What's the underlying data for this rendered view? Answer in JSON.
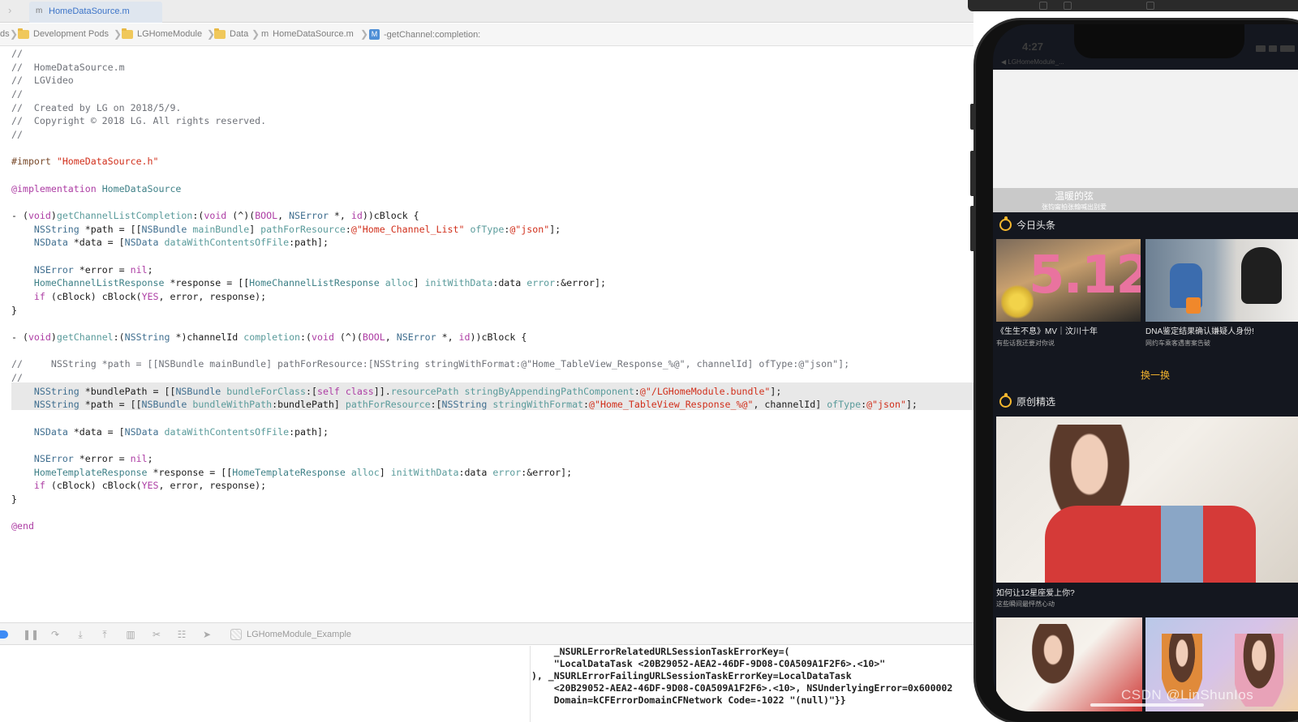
{
  "tabbar": {
    "active_tab": "HomeDataSource.m",
    "file_type_glyph": "m"
  },
  "jumpbar": {
    "items": [
      "ds",
      "Development Pods",
      "LGHomeModule",
      "Data",
      "HomeDataSource.m",
      "-getChannel:completion:"
    ],
    "file_glyph": "m",
    "method_glyph": "M"
  },
  "code": {
    "lines": [
      [
        [
          "c-comment",
          "//"
        ]
      ],
      [
        [
          "c-comment",
          "//  HomeDataSource.m"
        ]
      ],
      [
        [
          "c-comment",
          "//  LGVideo"
        ]
      ],
      [
        [
          "c-comment",
          "//"
        ]
      ],
      [
        [
          "c-comment",
          "//  Created by LG on 2018/5/9."
        ]
      ],
      [
        [
          "c-comment",
          "//  Copyright © 2018 LG. All rights reserved."
        ]
      ],
      [
        [
          "c-comment",
          "//"
        ]
      ],
      [],
      [
        [
          "c-pre",
          "#import "
        ],
        [
          "c-str",
          "\"HomeDataSource.h\""
        ]
      ],
      [],
      [
        [
          "c-kw",
          "@implementation"
        ],
        [
          "",
          " "
        ],
        [
          "c-proj",
          "HomeDataSource"
        ]
      ],
      [],
      [
        [
          "",
          "- ("
        ],
        [
          "c-kw",
          "void"
        ],
        [
          "",
          ")"
        ],
        [
          "c-method",
          "getChannelListCompletion"
        ],
        [
          "",
          ":("
        ],
        [
          "c-kw",
          "void"
        ],
        [
          "",
          " (^)("
        ],
        [
          "c-kw",
          "BOOL"
        ],
        [
          "",
          ", "
        ],
        [
          "c-type",
          "NSError"
        ],
        [
          "",
          " *, "
        ],
        [
          "c-kw",
          "id"
        ],
        [
          "",
          "))cBlock {"
        ]
      ],
      [
        [
          "",
          "    "
        ],
        [
          "c-type",
          "NSString"
        ],
        [
          "",
          " *path = [["
        ],
        [
          "c-type",
          "NSBundle"
        ],
        [
          "",
          "",
          " "
        ],
        [
          "c-method",
          "mainBundle"
        ],
        [
          "",
          "] "
        ],
        [
          "c-method",
          "pathForResource"
        ],
        [
          "",
          ":"
        ],
        [
          "c-str",
          "@\"Home_Channel_List\""
        ],
        [
          "",
          " "
        ],
        [
          "c-method",
          "ofType"
        ],
        [
          "",
          ":"
        ],
        [
          "c-str",
          "@\"json\""
        ],
        [
          "",
          "];"
        ]
      ],
      [
        [
          "",
          "    "
        ],
        [
          "c-type",
          "NSData"
        ],
        [
          "",
          "",
          " *data = ["
        ],
        [
          "c-type",
          "NSData"
        ],
        [
          "",
          " "
        ],
        [
          "c-method",
          "dataWithContentsOfFile"
        ],
        [
          "",
          ":path];"
        ]
      ],
      [],
      [
        [
          "",
          "    "
        ],
        [
          "c-type",
          "NSError"
        ],
        [
          "",
          "",
          " *error = "
        ],
        [
          "c-kw",
          "nil"
        ],
        [
          "",
          ";"
        ]
      ],
      [
        [
          "",
          "    "
        ],
        [
          "c-proj",
          "HomeChannelListResponse"
        ],
        [
          "",
          " *response = [["
        ],
        [
          "c-proj",
          "HomeChannelListResponse"
        ],
        [
          "",
          " "
        ],
        [
          "c-method",
          "alloc"
        ],
        [
          "",
          "] "
        ],
        [
          "c-method",
          "initWithData"
        ],
        [
          "",
          ":data "
        ],
        [
          "c-method",
          "error"
        ],
        [
          "",
          ":&error];"
        ]
      ],
      [
        [
          "",
          "    "
        ],
        [
          "c-kw",
          "if"
        ],
        [
          "",
          " (cBlock) cBlock("
        ],
        [
          "c-kw",
          "YES"
        ],
        [
          "",
          ", error, response);"
        ]
      ],
      [
        [
          "",
          "}"
        ]
      ],
      [],
      [
        [
          "",
          "- ("
        ],
        [
          "c-kw",
          "void"
        ],
        [
          "",
          ")"
        ],
        [
          "c-method",
          "getChannel"
        ],
        [
          "",
          ":("
        ],
        [
          "c-type",
          "NSString"
        ],
        [
          "",
          " *)channelId "
        ],
        [
          "c-method",
          "completion"
        ],
        [
          "",
          ":("
        ],
        [
          "c-kw",
          "void"
        ],
        [
          "",
          "",
          " (^)("
        ],
        [
          "c-kw",
          "BOOL"
        ],
        [
          "",
          ", "
        ],
        [
          "c-type",
          "NSError"
        ],
        [
          "",
          " *, "
        ],
        [
          "c-kw",
          "id"
        ],
        [
          "",
          "))cBlock {"
        ]
      ],
      [],
      [
        [
          "c-comment",
          "//     NSString *path = [[NSBundle mainBundle] pathForResource:[NSString stringWithFormat:@\"Home_TableView_Response_%@\", channelId] ofType:@\"json\"];"
        ]
      ],
      [
        [
          "c-comment",
          "//"
        ]
      ],
      [
        [
          "",
          "    "
        ],
        [
          "c-type",
          "NSString"
        ],
        [
          "",
          " *bundlePath = [["
        ],
        [
          "c-type",
          "NSBundle"
        ],
        [
          "",
          " "
        ],
        [
          "c-method",
          "bundleForClass"
        ],
        [
          "",
          ":["
        ],
        [
          "c-kw",
          "self"
        ],
        [
          "",
          " "
        ],
        [
          "c-kw",
          "class"
        ],
        [
          "",
          "]]."
        ],
        [
          "c-method",
          "resourcePath"
        ],
        [
          "",
          " "
        ],
        [
          "c-method",
          "stringByAppendingPathComponent"
        ],
        [
          "",
          ":"
        ],
        [
          "c-str",
          "@\"/LGHomeModule.bundle\""
        ],
        [
          "",
          "];"
        ]
      ],
      [
        [
          "",
          "    "
        ],
        [
          "c-type",
          "NSString"
        ],
        [
          "",
          " *path = [["
        ],
        [
          "c-type",
          "NSBundle"
        ],
        [
          "",
          " "
        ],
        [
          "c-method",
          "bundleWithPath"
        ],
        [
          "",
          ":bundlePath] "
        ],
        [
          "c-method",
          "pathForResource"
        ],
        [
          "",
          ":["
        ],
        [
          "c-type",
          "NSString"
        ],
        [
          "",
          " "
        ],
        [
          "c-method",
          "stringWithFormat"
        ],
        [
          "",
          ":"
        ],
        [
          "c-str",
          "@\"Home_TableView_Response_%@\""
        ],
        [
          "",
          ", channelId] "
        ],
        [
          "c-method",
          "ofType"
        ],
        [
          "",
          ":"
        ],
        [
          "c-str",
          "@\"json\""
        ],
        [
          "",
          "];"
        ]
      ],
      [],
      [
        [
          "",
          "    "
        ],
        [
          "c-type",
          "NSData"
        ],
        [
          "",
          " *data = ["
        ],
        [
          "c-type",
          "NSData"
        ],
        [
          "",
          " "
        ],
        [
          "c-method",
          "dataWithContentsOfFile"
        ],
        [
          "",
          ":path];"
        ]
      ],
      [],
      [
        [
          "",
          "    "
        ],
        [
          "c-type",
          "NSError"
        ],
        [
          "",
          " *error = "
        ],
        [
          "c-kw",
          "nil"
        ],
        [
          "",
          ";"
        ]
      ],
      [
        [
          "",
          "    "
        ],
        [
          "c-proj",
          "HomeTemplateResponse"
        ],
        [
          "",
          " *response = [["
        ],
        [
          "c-proj",
          "HomeTemplateResponse"
        ],
        [
          "",
          " "
        ],
        [
          "c-method",
          "alloc"
        ],
        [
          "",
          "] "
        ],
        [
          "c-method",
          "initWithData"
        ],
        [
          "",
          ":data "
        ],
        [
          "c-method",
          "error"
        ],
        [
          "",
          ":&error];"
        ]
      ],
      [
        [
          "",
          "    "
        ],
        [
          "c-kw",
          "if"
        ],
        [
          "",
          " (cBlock) cBlock("
        ],
        [
          "c-kw",
          "YES"
        ],
        [
          "",
          ", error, response);"
        ]
      ],
      [
        [
          "",
          "}"
        ]
      ],
      [],
      [
        [
          "c-kw",
          "@end"
        ]
      ]
    ],
    "highlighted_lines": [
      25,
      26
    ]
  },
  "debugbar": {
    "scheme": "LGHomeModule_Example"
  },
  "console": {
    "lines": [
      "    _NSURLErrorRelatedURLSessionTaskErrorKey=(",
      "    \"LocalDataTask <20B29052-AEA2-46DF-9D08-C0A509A1F2F6>.<10>\"",
      "), _NSURLErrorFailingURLSessionTaskErrorKey=LocalDataTask",
      "    <20B29052-AEA2-46DF-9D08-C0A509A1F2F6>.<10>, NSUnderlyingError=0x600002",
      "    Domain=kCFErrorDomainCFNetwork Code=-1022 \"(null)\"}}"
    ]
  },
  "simulator": {
    "status_time": "4:27",
    "status_back": "◀ LGHomeModule_...",
    "banner_title": "温暖的弦",
    "banner_subtitle": "张钧甯拍张翰喊出别爱",
    "section1_title": "今日头条",
    "card1_title": "《生生不息》MV｜汶川十年",
    "card1_sub": "有些话我还要对你说",
    "card1_poster_text": "5.12",
    "card2_title": "DNA鉴定结果确认嫌疑人身份!",
    "card2_sub": "网约车乘客遇害案告破",
    "refresh_label": "换一换",
    "section2_title": "原创精选",
    "feature_title": "如何让12星座爱上你?",
    "feature_sub": "这些瞬间最怦然心动",
    "accent": "#f5b82e"
  },
  "watermark": "CSDN @LinShunIos"
}
